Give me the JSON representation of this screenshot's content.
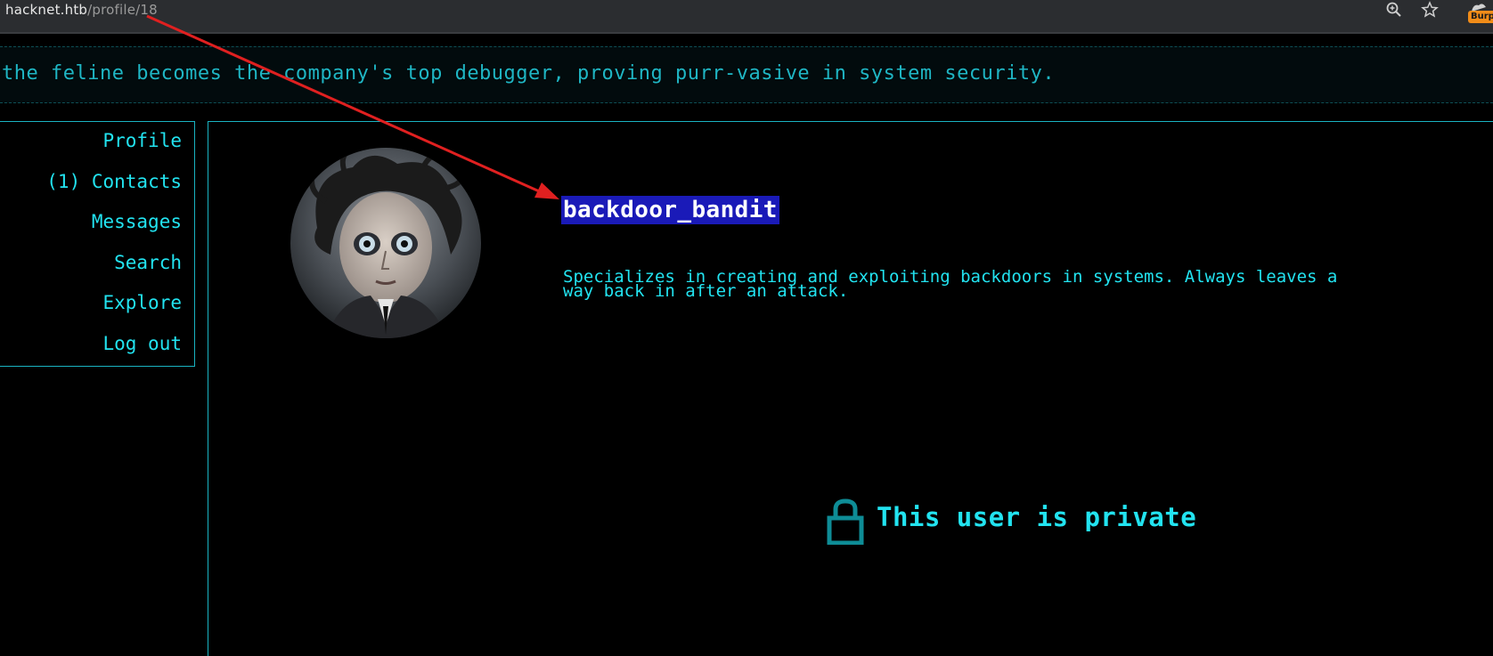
{
  "browser": {
    "url_host": "hacknet.htb",
    "url_path": "/profile/18",
    "extension_badge": "Burp"
  },
  "ticker": {
    "text": "the feline becomes the company's top debugger, proving purr-vasive in system security."
  },
  "sidebar": {
    "items": [
      {
        "label": "Profile"
      },
      {
        "label": "(1) Contacts"
      },
      {
        "label": "Messages"
      },
      {
        "label": "Search"
      },
      {
        "label": "Explore"
      },
      {
        "label": "Log out"
      }
    ]
  },
  "profile": {
    "username": "backdoor_bandit",
    "bio_line1": "Specializes in creating and exploiting backdoors in systems. Always leaves a",
    "bio_line2": "way back in after an attack.",
    "private_message": "This user is private"
  },
  "colors": {
    "accent": "#22e3f0",
    "border": "#1ab4c2",
    "highlight": "#1a1ab8",
    "annotation": "#e02020"
  },
  "icons": {
    "zoom": "zoom-icon",
    "bookmark": "star-icon",
    "lock": "lock-icon"
  }
}
